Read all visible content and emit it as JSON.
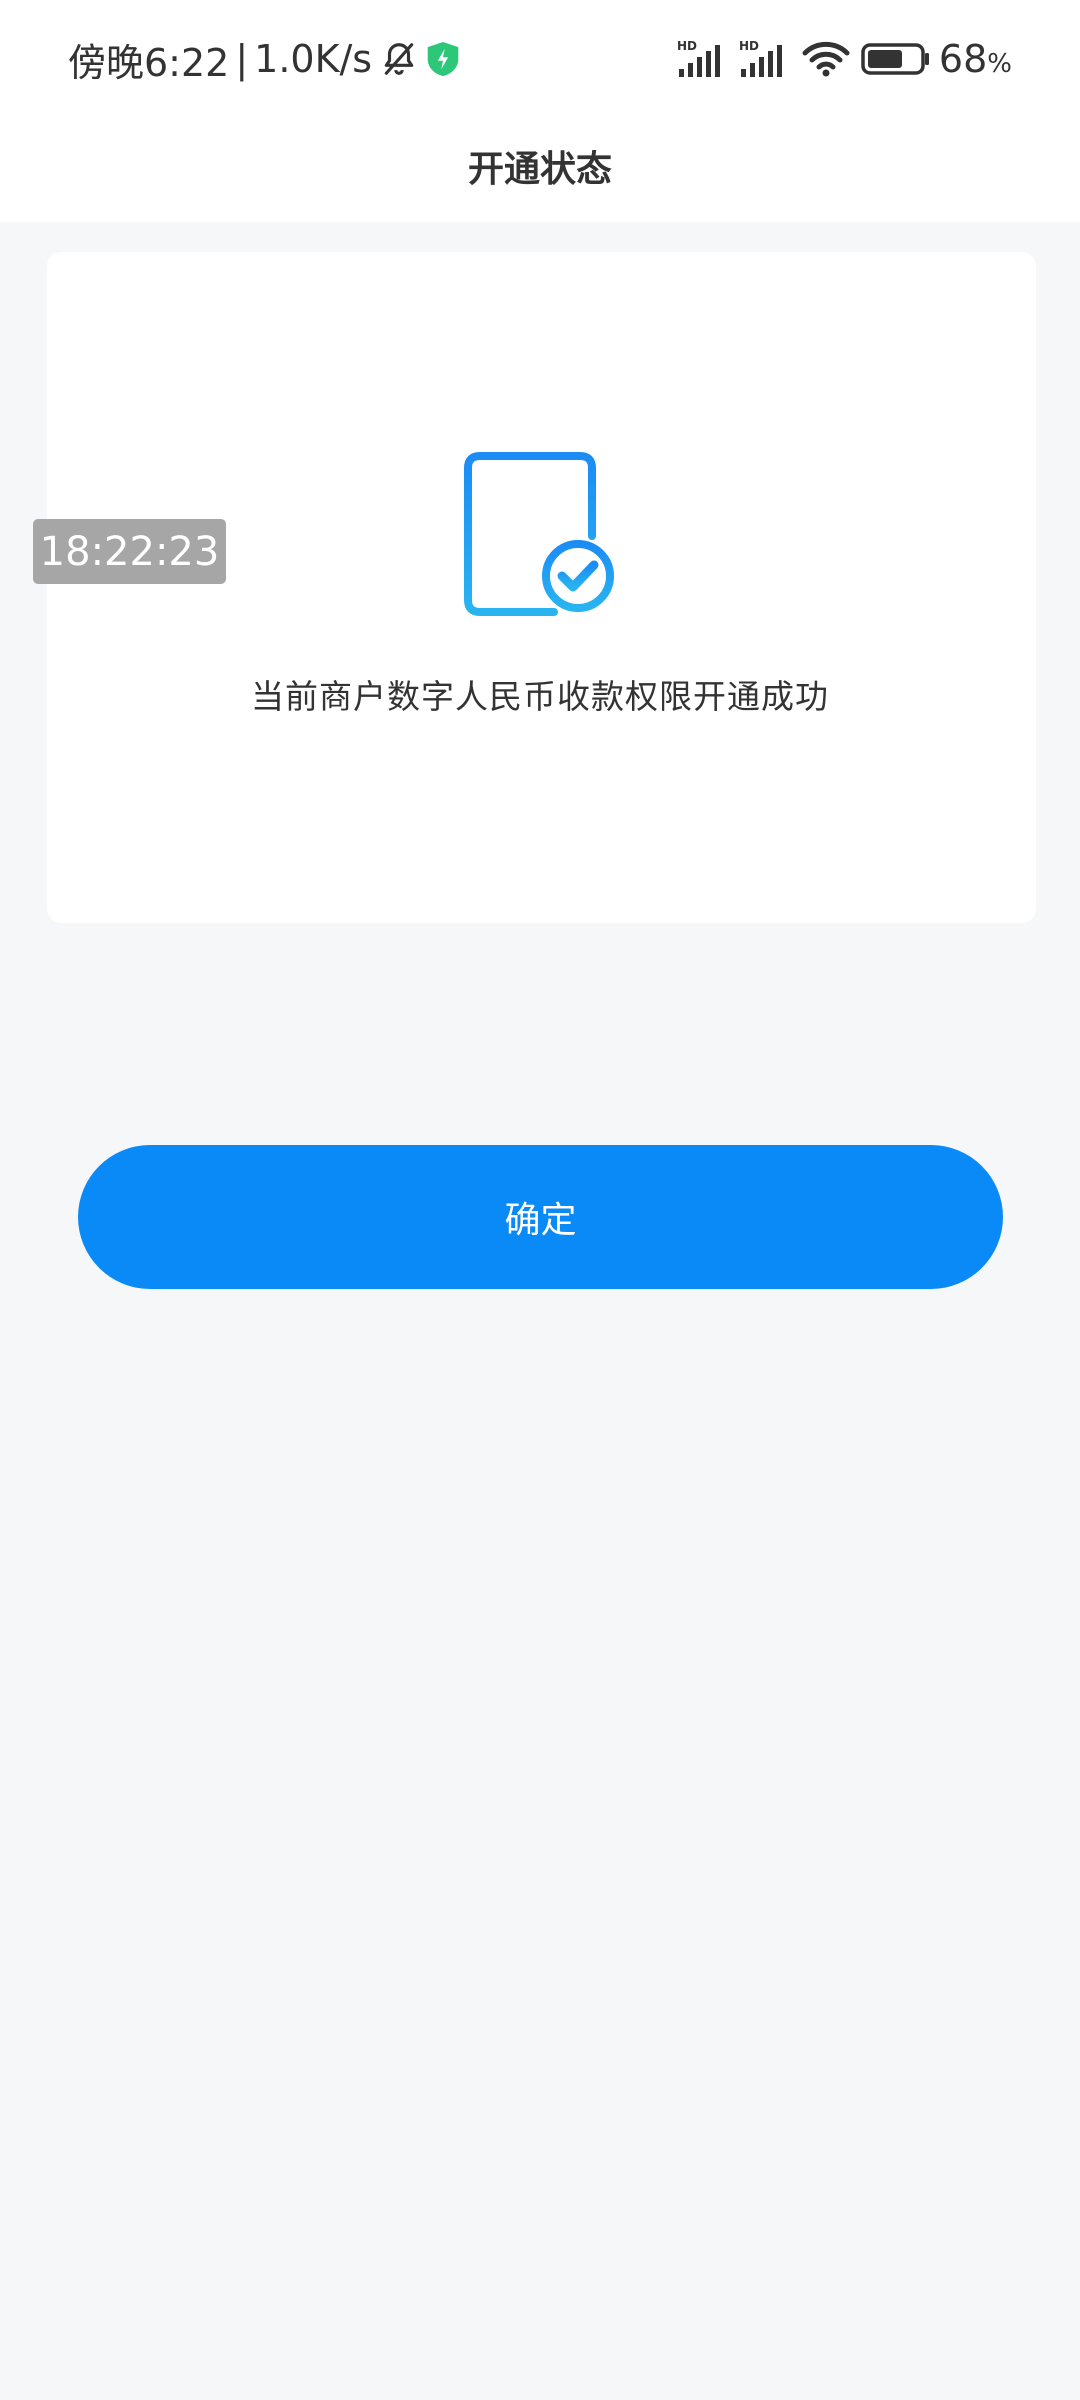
{
  "status_bar": {
    "time": "傍晚6:22",
    "separator": "|",
    "net_speed": "1.0K/s",
    "signal1_label": "HD",
    "signal2_label": "HD",
    "battery_value": "68",
    "battery_unit": "%",
    "battery_level": 0.68,
    "icons": [
      "bell-muted-icon",
      "shield-icon",
      "signal-icon",
      "signal-icon",
      "wifi-icon",
      "battery-icon"
    ]
  },
  "header": {
    "title": "开通状态"
  },
  "card": {
    "icon": "document-check-icon",
    "message": "当前商户数字人民币收款权限开通成功"
  },
  "overlay": {
    "time": "18:22:23"
  },
  "actions": {
    "confirm_label": "确定"
  },
  "colors": {
    "primary": "#0a8af6",
    "icon_gradient_start": "#29a8f0",
    "background": "#f6f7f9",
    "card": "#ffffff",
    "shield": "#2dc77a"
  }
}
